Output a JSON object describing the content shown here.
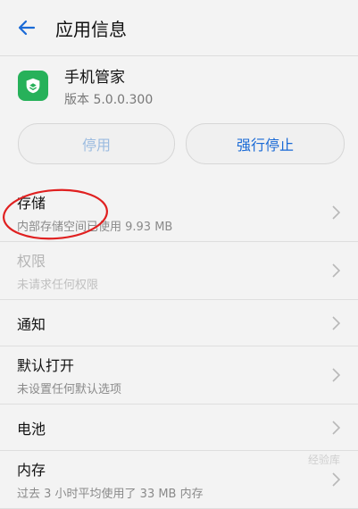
{
  "header": {
    "title": "应用信息",
    "back_icon": "arrow-left-icon"
  },
  "app": {
    "name": "手机管家",
    "version": "版本 5.0.0.300",
    "icon": "shield-icon",
    "icon_color": "#27b15a"
  },
  "buttons": {
    "disable_label": "停用",
    "force_stop_label": "强行停止"
  },
  "list": [
    {
      "title": "存储",
      "subtitle": "内部存储空间已使用 9.93 MB",
      "enabled": true
    },
    {
      "title": "权限",
      "subtitle": "未请求任何权限",
      "enabled": false
    },
    {
      "title": "通知",
      "enabled": true
    },
    {
      "title": "默认打开",
      "subtitle": "未设置任何默认选项",
      "enabled": true
    },
    {
      "title": "电池",
      "enabled": true
    },
    {
      "title": "内存",
      "subtitle": "过去 3 小时平均使用了 33 MB 内存",
      "enabled": true
    }
  ],
  "colors": {
    "accent": "#1a6ad6",
    "annotation": "#e02020"
  },
  "watermark": "经验库"
}
